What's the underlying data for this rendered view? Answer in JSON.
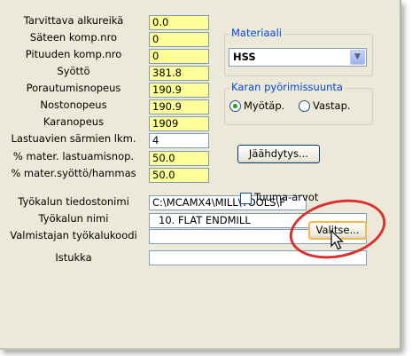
{
  "form": {
    "rows": [
      {
        "label": "Tarvittava alkureikä",
        "value": "0.0",
        "highlight": true
      },
      {
        "label": "Säteen  komp.nro",
        "value": "0",
        "highlight": true
      },
      {
        "label": "Pituuden komp.nro",
        "value": "0",
        "highlight": true
      },
      {
        "label": "Syöttö",
        "value": "381.8",
        "highlight": true
      },
      {
        "label": "Porautumisnopeus",
        "value": "190.9",
        "highlight": true
      },
      {
        "label": "Nostonopeus",
        "value": "190.9",
        "highlight": true
      },
      {
        "label": "Karanopeus",
        "value": "1909",
        "highlight": true
      },
      {
        "label": "Lastuavien särmien lkm.",
        "value": "4",
        "highlight": false
      },
      {
        "label": "% mater. lastuamisnop.",
        "value": "50.0",
        "highlight": true
      },
      {
        "label": "% mater.syöttö/hammas",
        "value": "50.0",
        "highlight": true
      }
    ],
    "tool_file_label": "Työkalun tiedostonimi",
    "tool_file_value": "C:\\MCAMX4\\MILL\\TOOLS\\F",
    "tool_name_label": "Työkalun nimi",
    "tool_name_value": "10. FLAT ENDMILL",
    "manufacturer_code_label": "Valmistajan työkalukoodi",
    "manufacturer_code_value": "",
    "holder_label": "Istukka",
    "holder_value": ""
  },
  "material": {
    "legend": "Materiaali",
    "selected": "HSS"
  },
  "spindle": {
    "legend": "Karan pyörimissuunta",
    "options": [
      "Myötäp.",
      "Vastap."
    ],
    "selected_index": 0
  },
  "buttons": {
    "coolant": "Jäähdytys...",
    "select": "Valitse..."
  },
  "checkbox": {
    "label": "Tuuma-arvot",
    "checked": false
  },
  "colors": {
    "highlight_field": "#ffff99",
    "annotation": "#d93030",
    "group_legend": "#0046d5"
  }
}
